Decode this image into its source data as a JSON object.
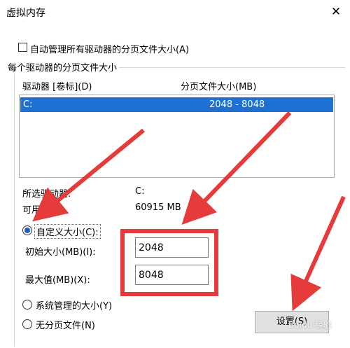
{
  "window": {
    "title": "虚拟内存",
    "close_glyph": "✕"
  },
  "auto_manage": {
    "checked": false,
    "label": "自动管理所有驱动器的分页文件大小(A)"
  },
  "group": {
    "title": "每个驱动器的分页文件大小",
    "columns": [
      "驱动器 [卷标](D)",
      "分页文件大小(MB)"
    ],
    "rows": [
      {
        "drive": "C:",
        "size": "2048 - 8048",
        "selected": true
      }
    ]
  },
  "selected_drive": {
    "drive_label": "所选驱动器:",
    "drive_value": "C:",
    "available_label": "可用空间:",
    "available_value": "60915 MB"
  },
  "options": {
    "custom_size_label": "自定义大小(C):",
    "initial_label": "初始大小(MB)(I):",
    "initial_value": "2048",
    "max_label": "最大值(MB)(X):",
    "max_value": "8048",
    "system_managed_label": "系统管理的大小(Y)",
    "no_paging_label": "无分页文件(N)",
    "selected": "custom"
  },
  "buttons": {
    "set_label": "设置(S)"
  },
  "watermark": "Baidu 经验",
  "colors": {
    "selection": "#1e70d2",
    "annotation_red": "#e53b3b"
  }
}
